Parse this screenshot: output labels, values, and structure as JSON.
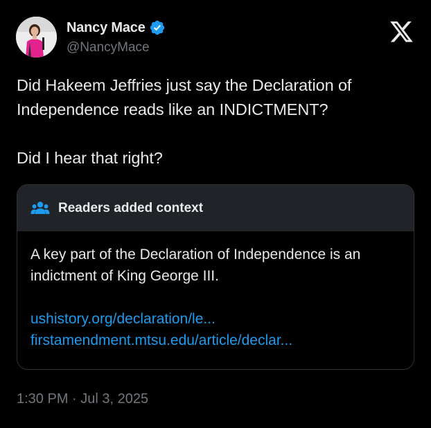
{
  "author": {
    "name": "Nancy Mace",
    "handle": "@NancyMace",
    "verified": true
  },
  "tweet": {
    "lines": [
      "Did Hakeem Jeffries just say the Declaration of",
      "Independence reads like an INDICTMENT?",
      "Did I hear that right?"
    ]
  },
  "context": {
    "title": "Readers added context",
    "icon": "people-icon",
    "body_lines": [
      "A key part of the Declaration of Independence is an",
      "indictment of King George III."
    ],
    "links": [
      "ushistory.org/declaration/le...",
      "firstamendment.mtsu.edu/article/declar..."
    ]
  },
  "timestamp": "1:30 PM · Jul 3, 2025",
  "colors": {
    "background": "#000000",
    "text": "#e7e9ea",
    "muted": "#71767b",
    "link": "#1d9bf0",
    "verified_badge": "#1d9bf0",
    "context_header_bg": "#202327",
    "border": "#2f3336"
  }
}
